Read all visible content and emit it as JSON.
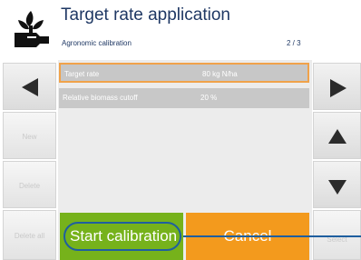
{
  "header": {
    "title": "Target rate application",
    "subtitle": "Agronomic calibration",
    "page": "2 / 3",
    "logo_icon": "plant-wrench-icon"
  },
  "left_buttons": [
    {
      "icon": "arrow-left-icon"
    },
    {
      "label": "New"
    },
    {
      "label": "Delete"
    },
    {
      "label": "Delete all"
    }
  ],
  "right_buttons": [
    {
      "icon": "arrow-right-icon"
    },
    {
      "icon": "arrow-up-icon"
    },
    {
      "icon": "arrow-down-icon"
    },
    {
      "label": "Select"
    }
  ],
  "rows": [
    {
      "label": "Target rate",
      "value": "80 kg N/ha",
      "selected": true
    },
    {
      "label": "Relative biomass cutoff",
      "value": "20 %",
      "selected": false
    }
  ],
  "actions": {
    "start": "Start calibration",
    "cancel": "Cancel"
  },
  "colors": {
    "title": "#1f3864",
    "start": "#76b21b",
    "cancel": "#f39a1d",
    "highlight": "#f0a24a"
  }
}
